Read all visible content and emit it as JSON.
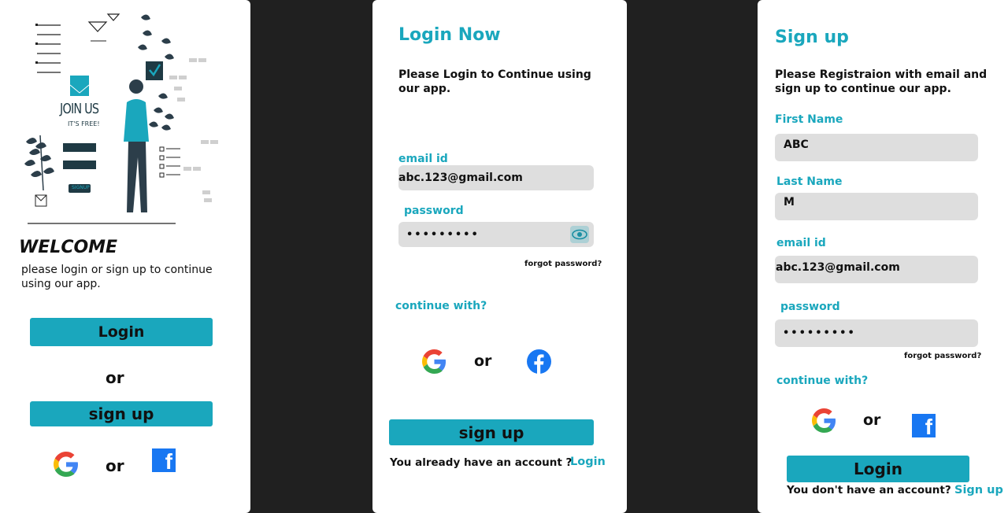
{
  "welcome": {
    "illustration_join": "JOIN US",
    "illustration_free": "IT'S FREE!",
    "illustration_signup": "SIGNUP",
    "title": "WELCOME",
    "subtitle": "please login or sign up to continue using our app.",
    "login_label": "Login",
    "or_label": "or",
    "signup_label": "sign up",
    "or_social": "or"
  },
  "login": {
    "title": "Login Now",
    "subtitle": "Please Login to Continue using our app.",
    "email_label": "email id",
    "email_value": "abc.123@gmail.com",
    "password_label": "password",
    "password_value": "•••••••••",
    "forgot": "forgot password?",
    "continue_with": "continue with?",
    "or_social": "or",
    "signup_label": "sign up",
    "have_account": "You already have an account ?",
    "login_link": "Login"
  },
  "signup": {
    "title": "Sign up",
    "subtitle": "Please Registraion with email and sign up to continue our app.",
    "first_name_label": "First Name",
    "first_name_value": "ABC",
    "last_name_label": "Last Name",
    "last_name_value": "M",
    "email_label": "email id",
    "email_value": "abc.123@gmail.com",
    "password_label": "password",
    "password_value": "•••••••••",
    "forgot": "forgot password?",
    "continue_with": "continue with?",
    "or_social": "or",
    "login_label": "Login",
    "no_account": "You don't have an account?",
    "signup_link": "Sign up"
  },
  "colors": {
    "accent": "#1aa7bd",
    "background": "#202020",
    "facebook": "#1877f2"
  },
  "icons": [
    "google-icon",
    "facebook-icon",
    "eye-icon"
  ]
}
